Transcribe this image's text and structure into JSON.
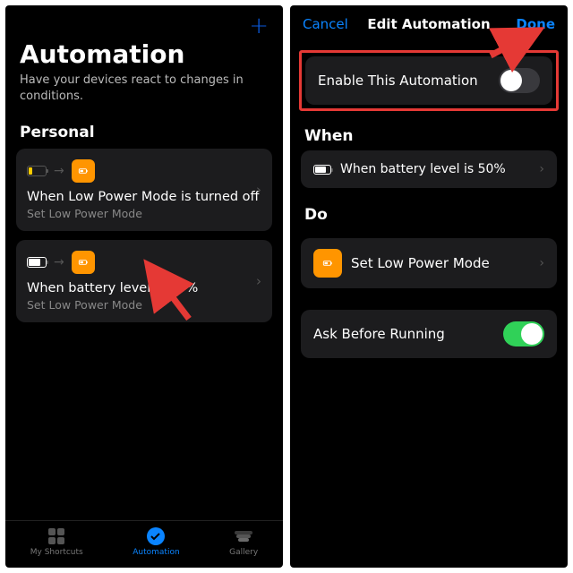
{
  "left": {
    "title": "Automation",
    "subtitle": "Have your devices react to changes in conditions.",
    "section": "Personal",
    "add_aria": "Add",
    "cards": [
      {
        "title": "When Low Power Mode is turned off",
        "subtitle": "Set Low Power Mode"
      },
      {
        "title": "When battery level is 50%",
        "subtitle": "Set Low Power Mode"
      }
    ],
    "tabs": [
      {
        "label": "My Shortcuts"
      },
      {
        "label": "Automation"
      },
      {
        "label": "Gallery"
      }
    ]
  },
  "right": {
    "cancel": "Cancel",
    "title": "Edit Automation",
    "done": "Done",
    "enable_label": "Enable This Automation",
    "enable_on": false,
    "when_head": "When",
    "when_row": "When battery level is 50%",
    "do_head": "Do",
    "do_row": "Set Low Power Mode",
    "ask_label": "Ask Before Running",
    "ask_on": true
  }
}
